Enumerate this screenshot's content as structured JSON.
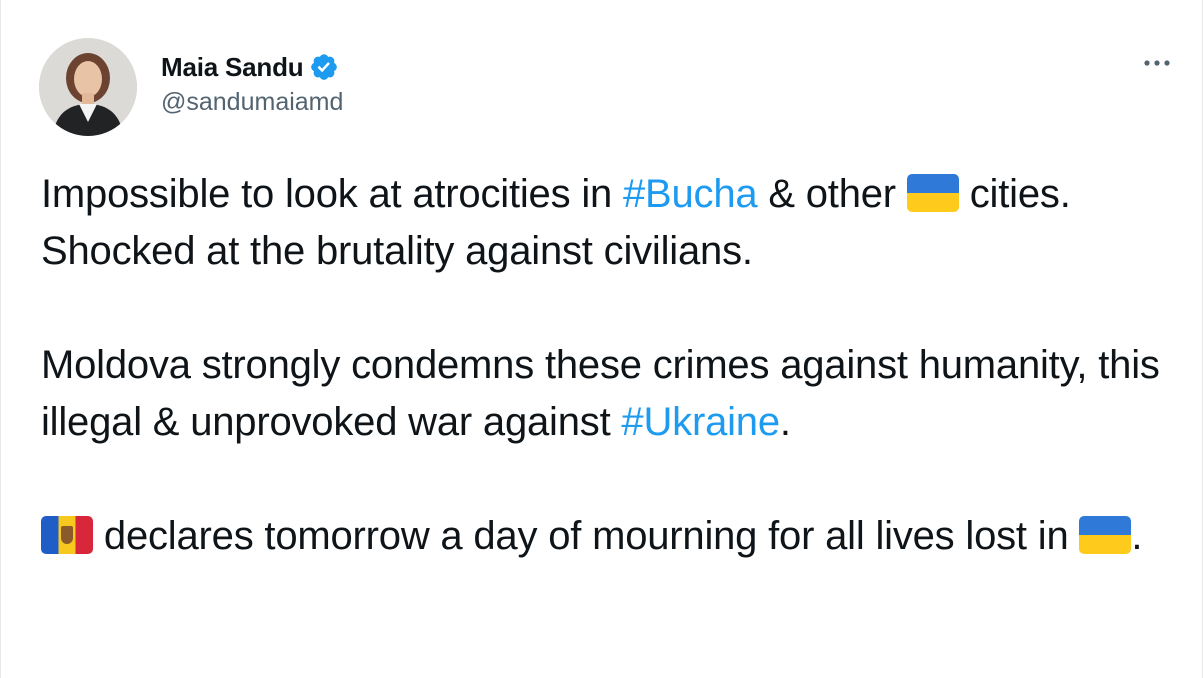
{
  "tweet": {
    "author": {
      "name": "Maia Sandu",
      "handle": "@sandumaiamd",
      "verified": true,
      "avatar_icon": "profile-photo-woman"
    },
    "more_icon": "more-horizontal-icon",
    "colors": {
      "text": "#0f1419",
      "secondary": "#536471",
      "link": "#1d9bf0",
      "verified_badge": "#1d9bf0"
    },
    "paragraphs": [
      {
        "segments": {
          "s1": "Impossible to look at atrocities in ",
          "hashtag": "#Bucha",
          "s2": " & other ",
          "flag": "flag-ukraine",
          "s3": " cities. Shocked at the brutality against civilians."
        }
      },
      {
        "segments": {
          "s1": "Moldova strongly condemns these crimes against humanity, this illegal & unprovoked war against ",
          "hashtag": "#Ukraine",
          "s2": "."
        }
      },
      {
        "segments": {
          "flag1": "flag-moldova",
          "s1": " declares tomorrow a day of mourning for all lives lost in ",
          "flag2": "flag-ukraine",
          "s2": "."
        }
      }
    ]
  }
}
